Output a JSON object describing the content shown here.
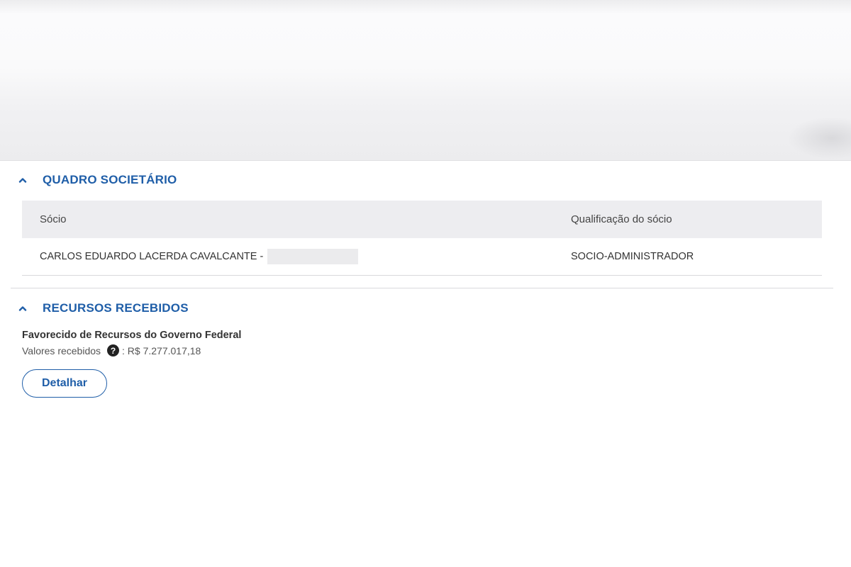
{
  "colors": {
    "accent": "#1f5ea8",
    "table_header_bg": "#ededf0",
    "text": "#333333"
  },
  "quadro_societario": {
    "title": "QUADRO SOCIETÁRIO",
    "toggle_icon": "chevron-up-icon",
    "columns": [
      "Sócio",
      "Qualificação do sócio"
    ],
    "rows": [
      {
        "socio": "CARLOS EDUARDO LACERDA CAVALCANTE -",
        "qualificacao": "SOCIO-ADMINISTRADOR"
      }
    ]
  },
  "recursos_recebidos": {
    "title": "RECURSOS RECEBIDOS",
    "toggle_icon": "chevron-up-icon",
    "favorecido_title": "Favorecido de Recursos do Governo Federal",
    "valores_label": "Valores recebidos",
    "help_icon": "question-circle-icon",
    "help_glyph": "?",
    "valores_value": ": R$ 7.277.017,18",
    "detalhar_label": "Detalhar"
  }
}
